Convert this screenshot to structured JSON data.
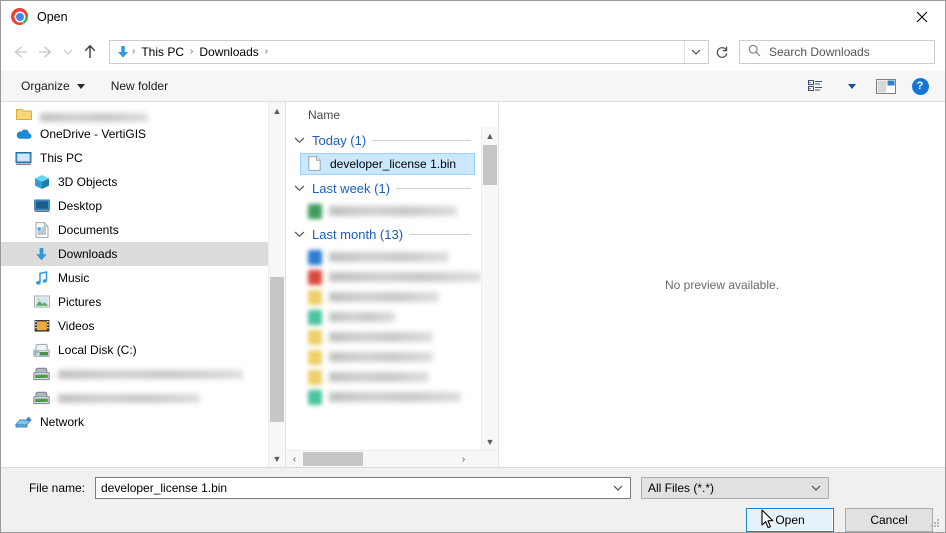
{
  "window": {
    "title": "Open",
    "app_icon": "chrome-logo-icon",
    "close_label": "✕"
  },
  "nav": {
    "back": "←",
    "forward": "→",
    "recent": "⌄",
    "up": "↑",
    "breadcrumb": {
      "location_icon": "downloads-arrow-icon",
      "items": [
        "This PC",
        "Downloads"
      ],
      "separator": "›"
    },
    "address_dropdown": "⌄",
    "refresh": "↻"
  },
  "search": {
    "placeholder": "Search Downloads",
    "icon": "search-icon"
  },
  "command_bar": {
    "organize": "Organize",
    "new_folder": "New folder",
    "view_icon": "view-options-icon",
    "preview_pane_icon": "preview-pane-icon",
    "help": "?"
  },
  "sidebar": {
    "items": [
      {
        "label": "",
        "icon": "folder-icon",
        "blurred": true,
        "indent": false,
        "selected": false,
        "blur_width": 108
      },
      {
        "label": "OneDrive - VertiGIS",
        "icon": "onedrive-icon",
        "blurred": false,
        "indent": false,
        "selected": false
      },
      {
        "label": "This PC",
        "icon": "this-pc-icon",
        "blurred": false,
        "indent": false,
        "selected": false
      },
      {
        "label": "3D Objects",
        "icon": "3d-objects-icon",
        "blurred": false,
        "indent": true,
        "selected": false
      },
      {
        "label": "Desktop",
        "icon": "desktop-icon",
        "blurred": false,
        "indent": true,
        "selected": false
      },
      {
        "label": "Documents",
        "icon": "documents-icon",
        "blurred": false,
        "indent": true,
        "selected": false
      },
      {
        "label": "Downloads",
        "icon": "downloads-icon",
        "blurred": false,
        "indent": true,
        "selected": true
      },
      {
        "label": "Music",
        "icon": "music-icon",
        "blurred": false,
        "indent": true,
        "selected": false
      },
      {
        "label": "Pictures",
        "icon": "pictures-icon",
        "blurred": false,
        "indent": true,
        "selected": false
      },
      {
        "label": "Videos",
        "icon": "videos-icon",
        "blurred": false,
        "indent": true,
        "selected": false
      },
      {
        "label": "Local Disk (C:)",
        "icon": "local-disk-icon",
        "blurred": false,
        "indent": true,
        "selected": false
      },
      {
        "label": "",
        "icon": "network-drive-icon",
        "blurred": true,
        "indent": true,
        "selected": false,
        "blur_width": 185
      },
      {
        "label": "",
        "icon": "network-drive-icon",
        "blurred": true,
        "indent": true,
        "selected": false,
        "blur_width": 142
      },
      {
        "label": "Network",
        "icon": "network-icon",
        "blurred": false,
        "indent": false,
        "selected": false
      }
    ]
  },
  "file_list": {
    "column_header": "Name",
    "groups": [
      {
        "label": "Today (1)",
        "collapse_icon": "chevron-down-icon",
        "files": [
          {
            "name": "developer_license 1.bin",
            "icon": "generic-file-icon",
            "selected": true,
            "blurred": false
          }
        ]
      },
      {
        "label": "Last week (1)",
        "collapse_icon": "chevron-down-icon",
        "files": [
          {
            "name": "",
            "icon": "excel-file-icon",
            "selected": false,
            "blurred": true,
            "blur_width": 128,
            "icon_color": "#3f9c5c"
          }
        ]
      },
      {
        "label": "Last month (13)",
        "collapse_icon": "chevron-down-icon",
        "files": [
          {
            "name": "",
            "icon": "word-file-icon",
            "selected": false,
            "blurred": true,
            "blur_width": 120,
            "icon_color": "#2b7cd3"
          },
          {
            "name": "",
            "icon": "image-file-icon",
            "selected": false,
            "blurred": true,
            "blur_width": 170,
            "icon_color": "#d94a3d"
          },
          {
            "name": "",
            "icon": "zip-file-icon",
            "selected": false,
            "blurred": true,
            "blur_width": 110,
            "icon_color": "#efd06a"
          },
          {
            "name": "",
            "icon": "archive-file-icon",
            "selected": false,
            "blurred": true,
            "blur_width": 66,
            "icon_color": "#49c39e"
          },
          {
            "name": "",
            "icon": "zip-file-icon",
            "selected": false,
            "blurred": true,
            "blur_width": 104,
            "icon_color": "#efd06a"
          },
          {
            "name": "",
            "icon": "zip-file-icon",
            "selected": false,
            "blurred": true,
            "blur_width": 104,
            "icon_color": "#efd06a"
          },
          {
            "name": "",
            "icon": "zip-file-icon",
            "selected": false,
            "blurred": true,
            "blur_width": 100,
            "icon_color": "#efd06a"
          },
          {
            "name": "",
            "icon": "archive-file-icon",
            "selected": false,
            "blurred": true,
            "blur_width": 132,
            "icon_color": "#49c39e"
          }
        ]
      }
    ],
    "hscroll": {
      "left_arrow": "‹",
      "right_arrow": "›"
    }
  },
  "preview": {
    "message": "No preview available."
  },
  "footer": {
    "filename_label": "File name:",
    "filename_value": "developer_license 1.bin",
    "filename_dropdown": "⌄",
    "filetype_value": "All Files (*.*)",
    "filetype_dropdown": "⌄",
    "open_button": "Open",
    "cancel_button": "Cancel"
  },
  "colors": {
    "selection_fill": "#cce8ff",
    "selection_border": "#99d1ff",
    "sidebar_selected": "#dcdcdc",
    "group_label": "#1b5fbe",
    "default_button_fill": "#e5f1fb",
    "default_button_border": "#1982d1",
    "help_blue": "#1177d1"
  }
}
